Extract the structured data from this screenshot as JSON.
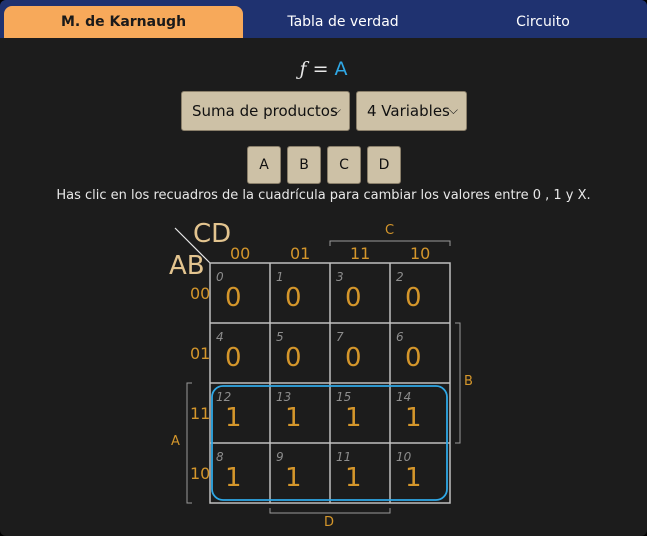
{
  "tabs": [
    "M. de Karnaugh",
    "Tabla de verdad",
    "Circuito"
  ],
  "formula": {
    "symbol": "ƒ",
    "equals": "=",
    "value": "A"
  },
  "selects": {
    "form": "Suma de productos",
    "vars": "4 Variables"
  },
  "var_buttons": [
    "A",
    "B",
    "C",
    "D"
  ],
  "hint": "Has clic en los recuadros de la cuadrícula para cambiar los valores entre 0 , 1 y X.",
  "kmap": {
    "col_var": "CD",
    "row_var": "AB",
    "col_headers": [
      "00",
      "01",
      "11",
      "10"
    ],
    "row_headers": [
      "00",
      "01",
      "11",
      "10"
    ],
    "group_labels": {
      "C": "C",
      "B": "B",
      "A": "A",
      "D": "D"
    },
    "cells": [
      [
        {
          "i": "0",
          "v": "0"
        },
        {
          "i": "1",
          "v": "0"
        },
        {
          "i": "3",
          "v": "0"
        },
        {
          "i": "2",
          "v": "0"
        }
      ],
      [
        {
          "i": "4",
          "v": "0"
        },
        {
          "i": "5",
          "v": "0"
        },
        {
          "i": "7",
          "v": "0"
        },
        {
          "i": "6",
          "v": "0"
        }
      ],
      [
        {
          "i": "12",
          "v": "1"
        },
        {
          "i": "13",
          "v": "1"
        },
        {
          "i": "15",
          "v": "1"
        },
        {
          "i": "14",
          "v": "1"
        }
      ],
      [
        {
          "i": "8",
          "v": "1"
        },
        {
          "i": "9",
          "v": "1"
        },
        {
          "i": "11",
          "v": "1"
        },
        {
          "i": "10",
          "v": "1"
        }
      ]
    ]
  },
  "colors": {
    "accent_tab": "#f7a95a",
    "nav": "#1f3270",
    "value": "#d4962b",
    "group_outline": "#2fa8e6"
  }
}
